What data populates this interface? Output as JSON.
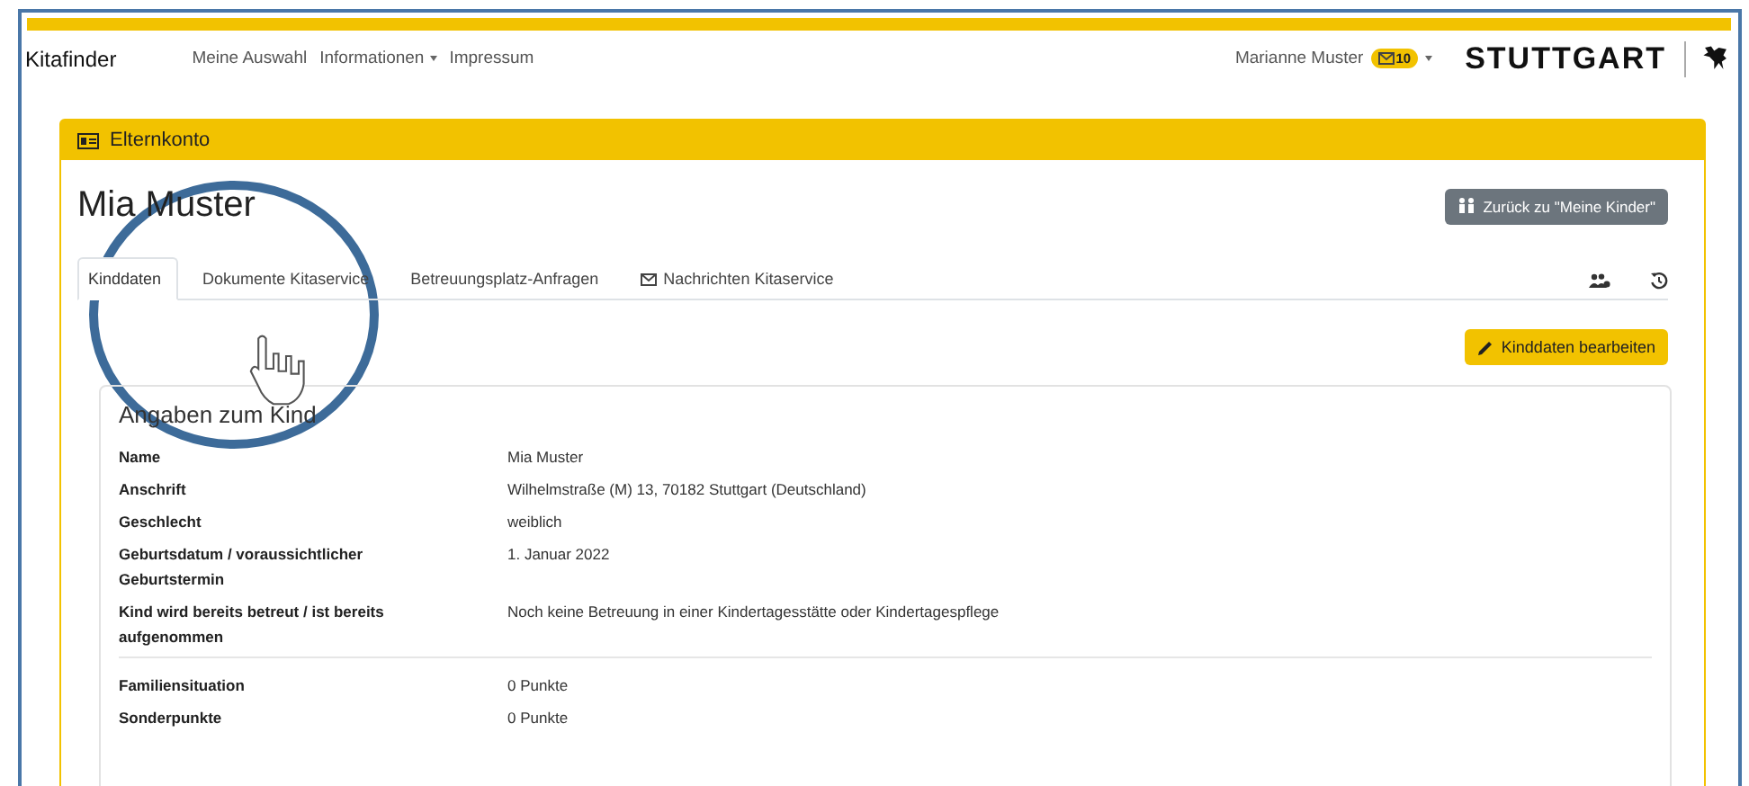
{
  "navbar": {
    "brand": "Kitafinder",
    "links": [
      {
        "label": "Meine Auswahl",
        "dropdown": false
      },
      {
        "label": "Informationen",
        "dropdown": true
      },
      {
        "label": "Impressum",
        "dropdown": false
      }
    ],
    "user": {
      "name": "Marianne Muster",
      "badge": "10"
    },
    "logo": "STUTTGART"
  },
  "panel": {
    "title": "Elternkonto",
    "child_name": "Mia Muster",
    "back_button": "Zurück zu \"Meine Kinder\"",
    "tabs": [
      {
        "label": "Kinddaten",
        "selected": true,
        "kind": "plain"
      },
      {
        "label": "Dokumente Kitaservice",
        "selected": false,
        "kind": "plain"
      },
      {
        "label": "Betreuungsplatz-Anfragen",
        "selected": false,
        "kind": "plain"
      },
      {
        "label": "Nachrichten Kitaservice",
        "selected": false,
        "kind": "mail"
      }
    ],
    "edit_button": "Kinddaten bearbeiten",
    "section": {
      "title": "Angaben zum Kind",
      "groups": [
        [
          {
            "label": "Name",
            "value": "Mia Muster"
          },
          {
            "label": "Anschrift",
            "value": "Wilhelmstraße (M) 13, 70182 Stuttgart (Deutschland)"
          },
          {
            "label": "Geschlecht",
            "value": "weiblich"
          },
          {
            "label": "Geburtsdatum / voraussichtlicher Geburtstermin",
            "value": "1. Januar 2022"
          },
          {
            "label": "Kind wird bereits betreut / ist bereits aufgenommen",
            "value": "Noch keine Betreuung in einer Kindertagesstätte oder Kindertagespflege"
          }
        ],
        [
          {
            "label": "Familiensituation",
            "value": "0 Punkte"
          },
          {
            "label": "Sonderpunkte",
            "value": "0 Punkte"
          }
        ]
      ]
    }
  }
}
